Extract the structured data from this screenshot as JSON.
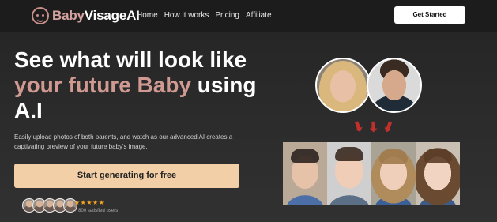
{
  "nav": {
    "logo_part1": "Baby",
    "logo_part2": "VisageAI",
    "links": [
      "Home",
      "How it works",
      "Pricing",
      "Affiliate"
    ],
    "cta_label": "Get Started"
  },
  "hero": {
    "title_line1": "See what will look like",
    "title_accent": "your future Baby",
    "title_rest": " using",
    "title_line3": "A.I",
    "description": "Easily upload photos of both parents, and watch as our advanced AI creates a captivating preview of your future baby's image.",
    "cta_label": "Start generating for free",
    "rating_stars": "★★★★★",
    "social_proof": "+ 800 satisfied users"
  },
  "colors": {
    "accent": "#d09a92",
    "cta": "#f2cfa6",
    "stars": "#f5a623",
    "arrows": "#c0302c"
  },
  "icons": {
    "logo": "baby-face-icon",
    "arrow": "arrow-down-icon",
    "star": "star-icon"
  }
}
